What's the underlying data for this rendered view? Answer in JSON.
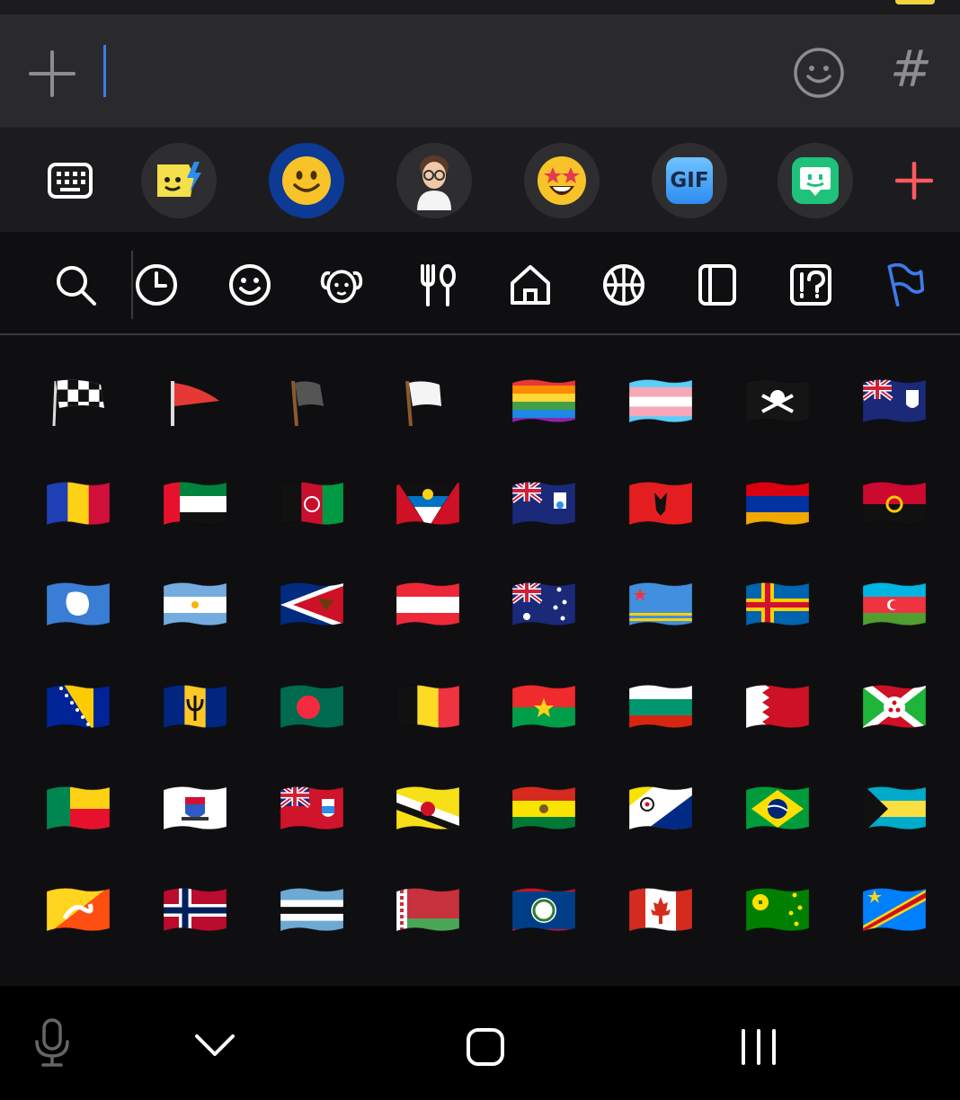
{
  "input": {
    "text": "",
    "placeholder": ""
  },
  "input_icons": {
    "add": "plus-icon",
    "emoji": "smiley-outline-icon",
    "hashtag": "#"
  },
  "toolbar": {
    "items": [
      {
        "name": "keyboard-icon"
      },
      {
        "name": "sticker-icon"
      },
      {
        "name": "emoji-icon",
        "selected": true
      },
      {
        "name": "avatar-icon"
      },
      {
        "name": "star-eyes-emoji-icon"
      },
      {
        "name": "gif-icon",
        "label": "GIF"
      },
      {
        "name": "bitmoji-icon"
      },
      {
        "name": "add-icon"
      }
    ]
  },
  "categories": [
    "search-icon",
    "recent-clock-icon",
    "smileys-icon",
    "animals-icon",
    "food-icon",
    "places-icon",
    "activities-icon",
    "objects-icon",
    "symbols-icon",
    "flags-icon"
  ],
  "active_category": "flags-icon",
  "flags": [
    "chequered-flag",
    "triangular-flag",
    "black-flag",
    "white-flag",
    "rainbow-flag",
    "transgender-flag",
    "pirate-flag",
    "ascension-island",
    "andorra",
    "united-arab-emirates",
    "afghanistan",
    "antigua-barbuda",
    "anguilla",
    "albania",
    "armenia",
    "angola",
    "antarctica",
    "argentina",
    "american-samoa",
    "austria",
    "australia",
    "aruba",
    "aland-islands",
    "azerbaijan",
    "bosnia-herzegovina",
    "barbados",
    "bangladesh",
    "belgium",
    "burkina-faso",
    "bulgaria",
    "bahrain",
    "burundi",
    "benin",
    "st-barthelemy",
    "bermuda",
    "brunei",
    "bolivia",
    "caribbean-netherlands",
    "brazil",
    "bahamas",
    "bhutan",
    "bouvet-island",
    "botswana",
    "belarus",
    "belize",
    "canada",
    "cocos-islands",
    "congo-kinshasa"
  ],
  "navbar": [
    "microphone-icon",
    "chevron-down-icon",
    "home-icon",
    "recents-icon"
  ],
  "colors": {
    "accent_blue": "#3d7be8",
    "selected_bg": "#0c3a94",
    "add_red": "#ff5a5f"
  }
}
